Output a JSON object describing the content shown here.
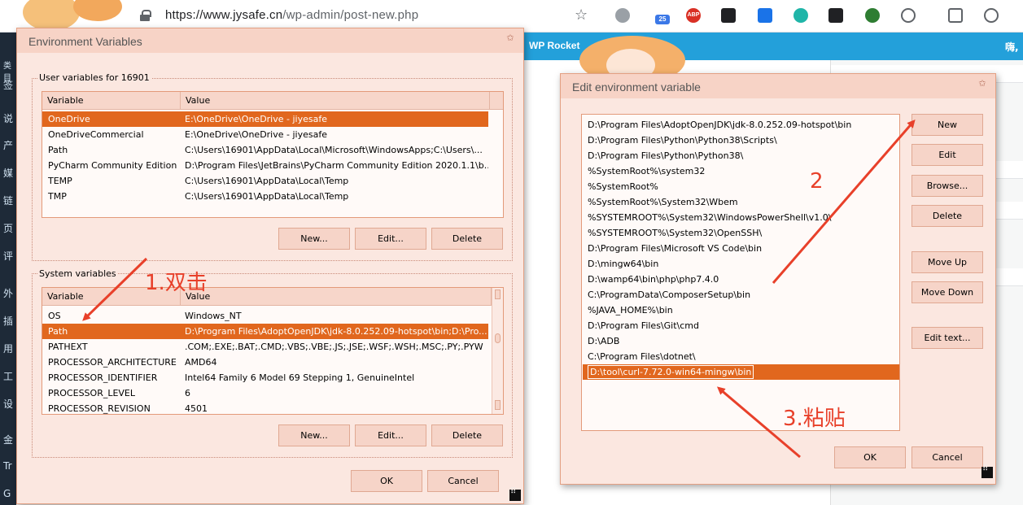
{
  "browser": {
    "url_host": "https://www.jysafe.cn",
    "url_path": "/wp-admin/post-new.php",
    "ext_badge": "25",
    "ext_abp": "ABP"
  },
  "wp": {
    "bar_text": "WP Rocket",
    "greeting": "嗨,",
    "sidebar_chars": [
      "类目",
      "签",
      "说",
      "产",
      "媒",
      "链",
      "页",
      "评",
      "外",
      "插",
      "用",
      "工",
      "设",
      "金",
      "Tr",
      "G"
    ]
  },
  "env_dialog": {
    "title": "Environment Variables",
    "user_group_label": "User variables for 16901",
    "col_variable": "Variable",
    "col_value": "Value",
    "user_vars": [
      {
        "name": "OneDrive",
        "value": "E:\\OneDrive\\OneDrive - jiyesafe",
        "selected": true
      },
      {
        "name": "OneDriveCommercial",
        "value": "E:\\OneDrive\\OneDrive - jiyesafe",
        "selected": false
      },
      {
        "name": "Path",
        "value": "C:\\Users\\16901\\AppData\\Local\\Microsoft\\WindowsApps;C:\\Users\\...",
        "selected": false
      },
      {
        "name": "PyCharm Community Edition",
        "value": "D:\\Program Files\\JetBrains\\PyCharm Community Edition 2020.1.1\\b...",
        "selected": false
      },
      {
        "name": "TEMP",
        "value": "C:\\Users\\16901\\AppData\\Local\\Temp",
        "selected": false
      },
      {
        "name": "TMP",
        "value": "C:\\Users\\16901\\AppData\\Local\\Temp",
        "selected": false
      }
    ],
    "system_group_label": "System variables",
    "system_vars": [
      {
        "name": "OS",
        "value": "Windows_NT",
        "selected": false
      },
      {
        "name": "Path",
        "value": "D:\\Program Files\\AdoptOpenJDK\\jdk-8.0.252.09-hotspot\\bin;D:\\Pro...",
        "selected": true
      },
      {
        "name": "PATHEXT",
        "value": ".COM;.EXE;.BAT;.CMD;.VBS;.VBE;.JS;.JSE;.WSF;.WSH;.MSC;.PY;.PYW",
        "selected": false
      },
      {
        "name": "PROCESSOR_ARCHITECTURE",
        "value": "AMD64",
        "selected": false
      },
      {
        "name": "PROCESSOR_IDENTIFIER",
        "value": "Intel64 Family 6 Model 69 Stepping 1, GenuineIntel",
        "selected": false
      },
      {
        "name": "PROCESSOR_LEVEL",
        "value": "6",
        "selected": false
      },
      {
        "name": "PROCESSOR_REVISION",
        "value": "4501",
        "selected": false
      }
    ],
    "btn_new": "New...",
    "btn_edit": "Edit...",
    "btn_delete": "Delete",
    "btn_ok": "OK",
    "btn_cancel": "Cancel"
  },
  "edit_dialog": {
    "title": "Edit environment variable",
    "paths": [
      "D:\\Program Files\\AdoptOpenJDK\\jdk-8.0.252.09-hotspot\\bin",
      "D:\\Program Files\\Python\\Python38\\Scripts\\",
      "D:\\Program Files\\Python\\Python38\\",
      "%SystemRoot%\\system32",
      "%SystemRoot%",
      "%SystemRoot%\\System32\\Wbem",
      "%SYSTEMROOT%\\System32\\WindowsPowerShell\\v1.0\\",
      "%SYSTEMROOT%\\System32\\OpenSSH\\",
      "D:\\Program Files\\Microsoft VS Code\\bin",
      "D:\\mingw64\\bin",
      "D:\\wamp64\\bin\\php\\php7.4.0",
      "C:\\ProgramData\\ComposerSetup\\bin",
      "%JAVA_HOME%\\bin",
      "D:\\Program Files\\Git\\cmd",
      "D:\\ADB",
      "C:\\Program Files\\dotnet\\"
    ],
    "editing_path": "D:\\tool\\curl-7.72.0-win64-mingw\\bin",
    "btn_new": "New",
    "btn_edit": "Edit",
    "btn_browse": "Browse...",
    "btn_delete": "Delete",
    "btn_move_up": "Move Up",
    "btn_move_down": "Move Down",
    "btn_edit_text": "Edit text...",
    "btn_ok": "OK",
    "btn_cancel": "Cancel"
  },
  "annotations": {
    "step1": "1.双击",
    "step2": "2",
    "step3": "3.粘贴",
    "arrow_color": "#e8402a"
  },
  "colors": {
    "selection": "#e1671e",
    "dialog_bg": "#fbe7e0",
    "title_bg": "#f7d3c6"
  }
}
